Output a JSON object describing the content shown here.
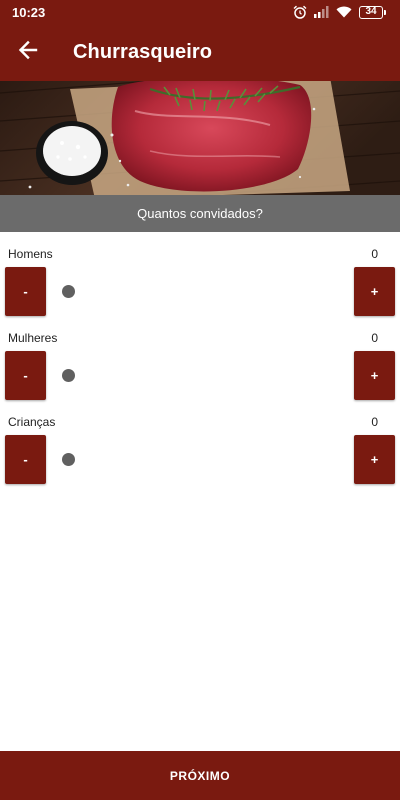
{
  "status_bar": {
    "time": "10:23",
    "battery": "34"
  },
  "app_bar": {
    "title": "Churrasqueiro",
    "back_icon": "arrow-back-icon"
  },
  "hero": {
    "image": "raw-steak-with-rosemary-and-salt"
  },
  "section_title": "Quantos convidados?",
  "counters": [
    {
      "label": "Homens",
      "value": "0",
      "minus": "-",
      "plus": "+",
      "slider_fraction": 0
    },
    {
      "label": "Mulheres",
      "value": "0",
      "minus": "-",
      "plus": "+",
      "slider_fraction": 0
    },
    {
      "label": "Crianças",
      "value": "0",
      "minus": "-",
      "plus": "+",
      "slider_fraction": 0
    }
  ],
  "next_button": "PRÓXIMO",
  "colors": {
    "primary": "#7a1a10",
    "subheader": "#6b6b6b",
    "slider_thumb": "#606060"
  }
}
